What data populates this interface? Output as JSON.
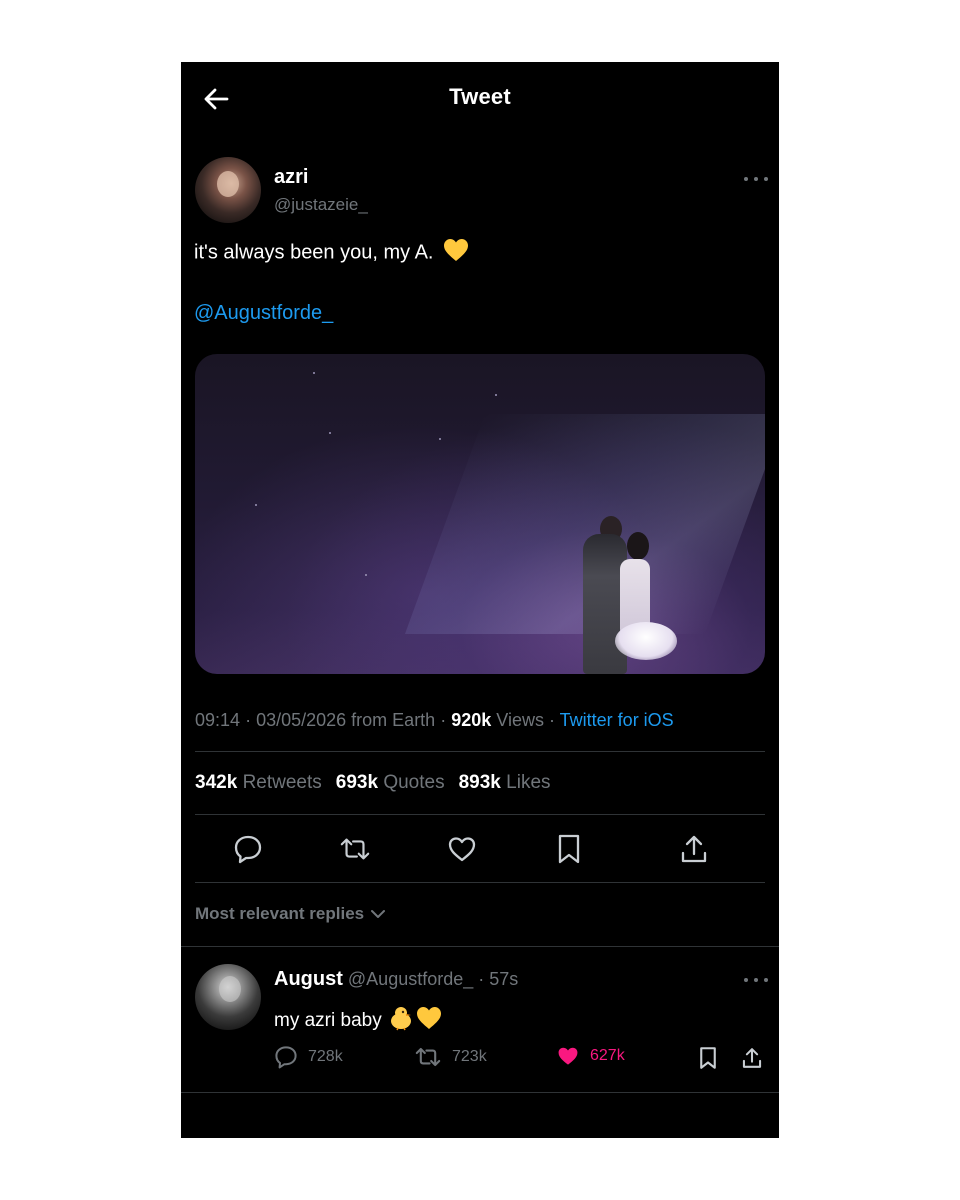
{
  "header": {
    "title": "Tweet",
    "back_icon": "arrow-left-icon"
  },
  "tweet": {
    "author_name": "azri",
    "author_handle": "@justazeie_",
    "text": "it's always been you, my A.",
    "text_emoji": "yellow-heart-icon",
    "mention": "@Augustforde_",
    "time": "09:14",
    "date": "03/05/2026",
    "location": "from Earth",
    "views_count": "920k",
    "views_label": "Views",
    "client": "Twitter for iOS",
    "stats": {
      "retweets_count": "342k",
      "retweets_label": "Retweets",
      "quotes_count": "693k",
      "quotes_label": "Quotes",
      "likes_count": "893k",
      "likes_label": "Likes"
    },
    "actions": [
      "reply-icon",
      "retweet-icon",
      "like-icon",
      "bookmark-icon",
      "share-icon"
    ]
  },
  "replies": {
    "filter_label": "Most relevant replies",
    "items": [
      {
        "author_name": "August",
        "author_handle": "@Augustforde_",
        "age": "57s",
        "text": "my azri baby",
        "text_emojis": [
          "chick-icon",
          "yellow-heart-icon"
        ],
        "reply_count": "728k",
        "retweet_count": "723k",
        "like_count": "627k",
        "liked": true
      }
    ]
  },
  "colors": {
    "background": "#000000",
    "text": "#ffffff",
    "muted": "#71767b",
    "link": "#1d9bf0",
    "like": "#f91880",
    "divider": "#2f3336",
    "heart_emoji": "#ffc83d"
  }
}
